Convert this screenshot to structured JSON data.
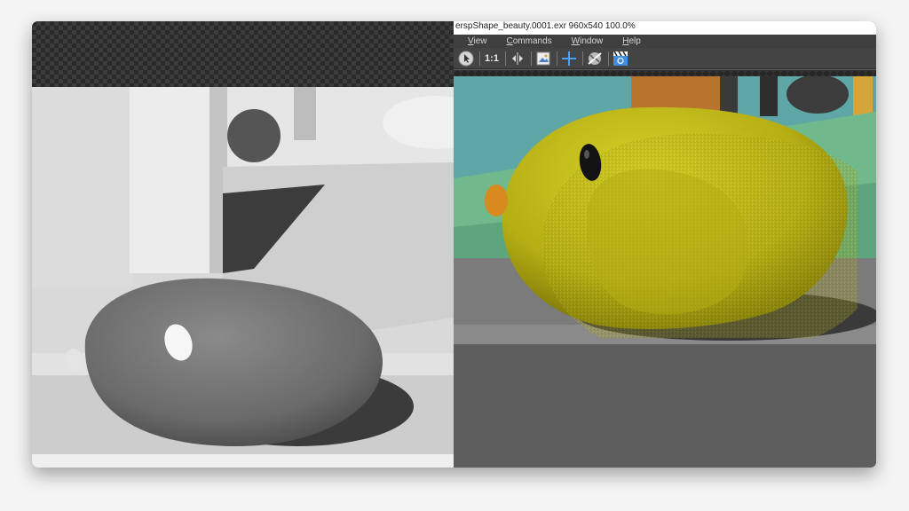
{
  "window": {
    "title": "erspShape_beauty.0001.exr 960x540 100.0%"
  },
  "menu": {
    "items": [
      {
        "label": "View",
        "u": "V",
        "rest": "iew"
      },
      {
        "label": "Commands",
        "u": "C",
        "rest": "ommands"
      },
      {
        "label": "Window",
        "u": "W",
        "rest": "indow"
      },
      {
        "label": "Help",
        "u": "H",
        "rest": "elp"
      }
    ]
  },
  "toolbar": {
    "ratio_label": "1:1",
    "icons": [
      "cursor-icon",
      "ratio-button",
      "split-compare-icon",
      "image-icon",
      "crosshair-icon",
      "render-region-icon",
      "clapper-icon"
    ]
  },
  "colors": {
    "accent_blue": "#3d8fe0",
    "chick_yellow": "#c8c21a",
    "wall_teal": "#5ea7a6",
    "floor_green": "#6fb98c"
  }
}
